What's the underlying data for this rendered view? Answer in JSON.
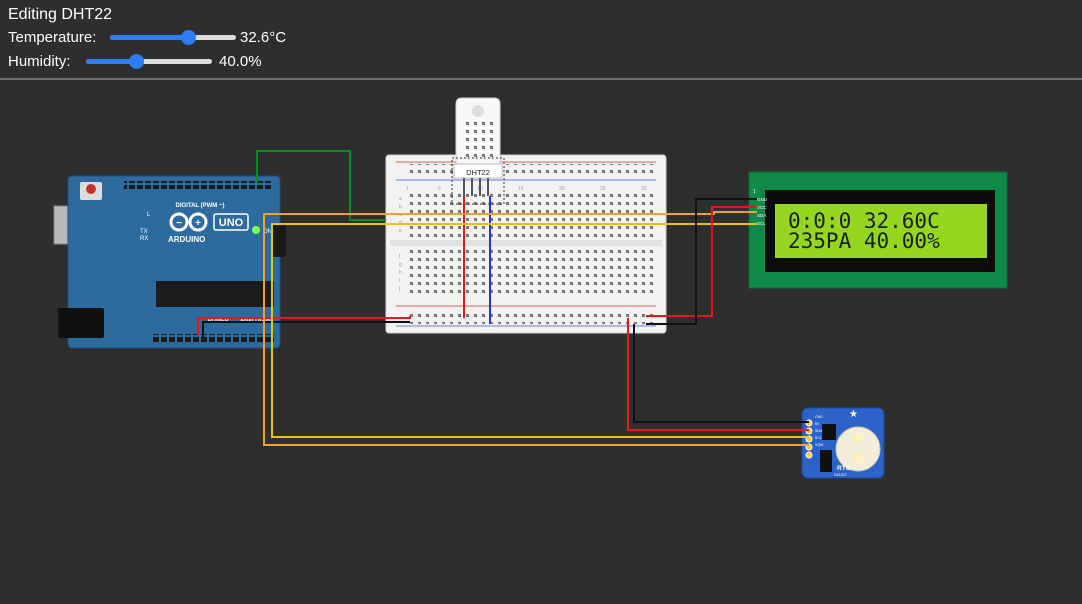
{
  "panel": {
    "title": "Editing DHT22",
    "temperature": {
      "label": "Temperature:",
      "value": "32.6°C",
      "fraction": 0.62
    },
    "humidity": {
      "label": "Humidity:",
      "value": "40.0%",
      "fraction": 0.4
    }
  },
  "arduino": {
    "logo": "ARDUINO",
    "model": "UNO",
    "on_label": "ON",
    "tx_label": "TX",
    "rx_label": "RX",
    "l_label": "L",
    "digital_label": "DIGITAL (PWM ~)",
    "power_label": "POWER",
    "analog_label": "ANALOG IN"
  },
  "breadboard": {
    "col_labels": [
      "1",
      "5",
      "10",
      "15",
      "20",
      "25",
      "30"
    ],
    "row_labels_top": [
      "a",
      "b",
      "c",
      "d",
      "e"
    ],
    "row_labels_bottom": [
      "f",
      "g",
      "h",
      "i",
      "j"
    ]
  },
  "dht22": {
    "label": "DHT22"
  },
  "lcd": {
    "line1": "0:0:0 32.60C",
    "line2": "235PA 40.00%",
    "pins": [
      "GND",
      "VCC",
      "SDA",
      "SCL"
    ],
    "pin_index": "1"
  },
  "rtc": {
    "label": "RTC",
    "chip": "DS1307",
    "pins": [
      "GND",
      "5V",
      "SDA",
      "SCL",
      "SQW"
    ]
  },
  "colors": {
    "background": "#2e2e2e",
    "arduino": "#2d6b9f",
    "lcd_board": "#0f8a49",
    "lcd_screen": "#96d620",
    "rtc_board": "#2c63c8",
    "wire_red": "#e01919",
    "wire_black": "#111111",
    "wire_green": "#0a8a24",
    "wire_blue": "#2233dd",
    "wire_yellow": "#f0c010",
    "wire_orange": "#f0a030",
    "slider_accent": "#2d7df6"
  }
}
